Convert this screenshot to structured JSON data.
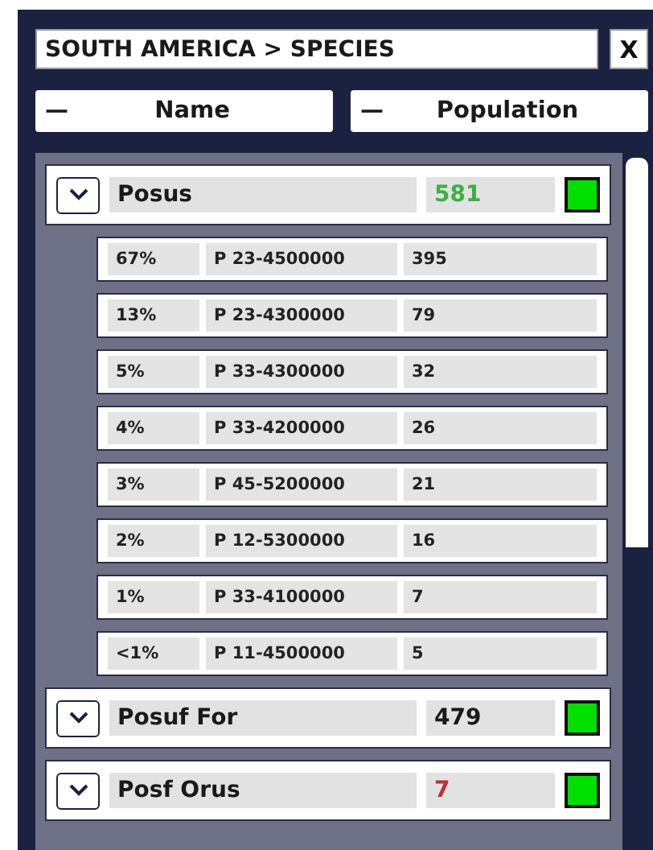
{
  "title": "SOUTH AMERICA > SPECIES",
  "close": "X",
  "columns": [
    {
      "sort": "—",
      "label": "Name"
    },
    {
      "sort": "—",
      "label": "Population"
    }
  ],
  "species": [
    {
      "name": "Posus",
      "count": "581",
      "color": "#3cb043",
      "children": [
        {
          "share": "67%",
          "code": "P 23-4500000",
          "count": "395"
        },
        {
          "share": "13%",
          "code": "P 23-4300000",
          "count": "79"
        },
        {
          "share": "5%",
          "code": "P 33-4300000",
          "count": "32"
        },
        {
          "share": "4%",
          "code": "P 33-4200000",
          "count": "26"
        },
        {
          "share": "3%",
          "code": "P 45-5200000",
          "count": "21"
        },
        {
          "share": "2%",
          "code": "P 12-5300000",
          "count": "16"
        },
        {
          "share": "1%",
          "code": "P 33-4100000",
          "count": "7"
        },
        {
          "share": "<1%",
          "code": "P 11-4500000",
          "count": "5"
        }
      ]
    },
    {
      "name": "Posuf For",
      "count": "479",
      "color": "#1a1a1a"
    },
    {
      "name": "Posf Orus",
      "count": "7",
      "color": "#c03030"
    }
  ]
}
